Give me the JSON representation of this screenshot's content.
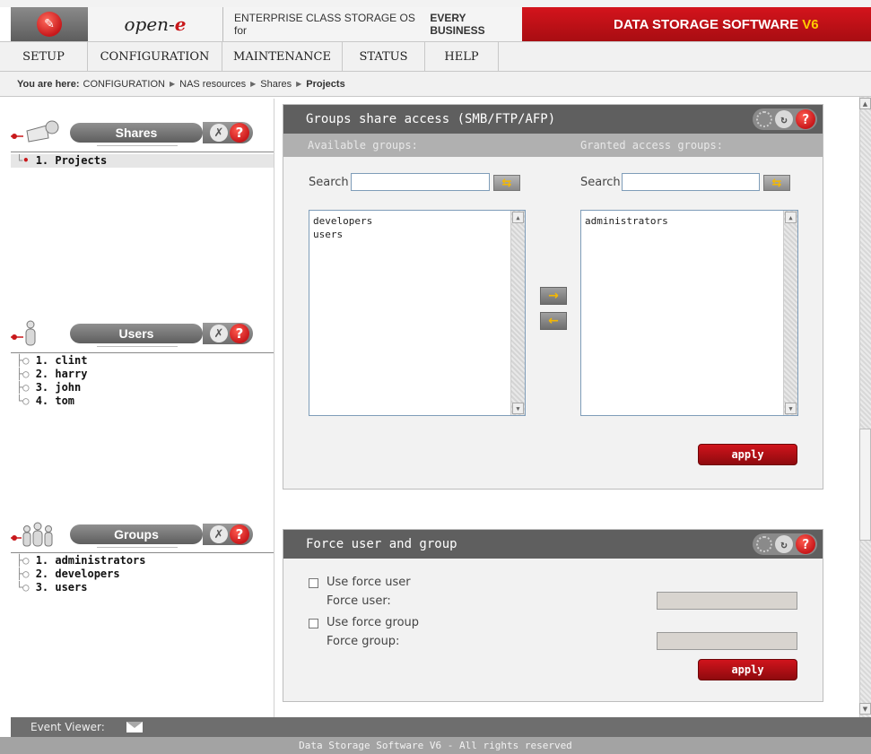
{
  "header": {
    "brand": "open-",
    "brand_e": "e",
    "tagline_pre": "ENTERPRISE CLASS STORAGE OS for ",
    "tagline_bold": "EVERY BUSINESS",
    "product": "DATA STORAGE SOFTWARE ",
    "product_version": "V6"
  },
  "nav": [
    "SETUP",
    "CONFIGURATION",
    "MAINTENANCE",
    "STATUS",
    "HELP"
  ],
  "breadcrumb": {
    "prefix": "You are here:",
    "items": [
      "CONFIGURATION",
      "NAS resources",
      "Shares"
    ],
    "current": "Projects"
  },
  "left": {
    "shares": {
      "title": "Shares",
      "items": [
        "1. Projects"
      ]
    },
    "users": {
      "title": "Users",
      "items": [
        "1. clint",
        "2. harry",
        "3. john",
        "4. tom"
      ]
    },
    "groups": {
      "title": "Groups",
      "items": [
        "1. administrators",
        "2. developers",
        "3. users"
      ]
    }
  },
  "group_access": {
    "title": "Groups share access (SMB/FTP/AFP)",
    "available_label": "Available groups:",
    "granted_label": "Granted access groups:",
    "search_label": "Search",
    "available": [
      "developers",
      "users"
    ],
    "granted": [
      "administrators"
    ],
    "apply": "apply"
  },
  "force": {
    "title": "Force user and group",
    "use_force_user": "Use force user",
    "force_user": "Force user:",
    "use_force_group": "Use force group",
    "force_group": "Force group:",
    "apply": "apply"
  },
  "footer": {
    "event_viewer": "Event Viewer:",
    "copyright": "Data Storage Software V6 - All rights reserved"
  },
  "colors": {
    "brand_red": "#c8181b",
    "dark_grey": "#5f5f5f",
    "accent_yellow": "#f5b800"
  }
}
